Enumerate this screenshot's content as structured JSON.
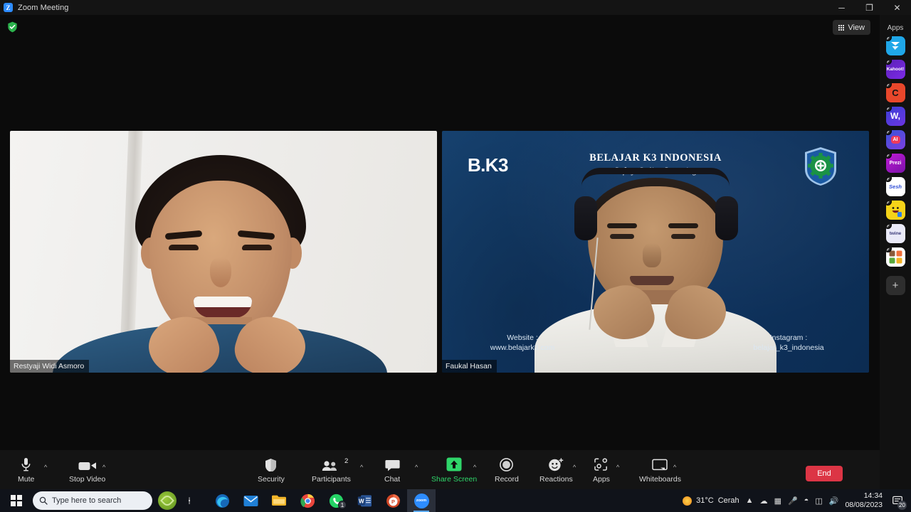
{
  "window": {
    "title": "Zoom Meeting",
    "logo_letter": "Z",
    "minimize": "─",
    "maximize": "❐",
    "close": "✕"
  },
  "header": {
    "encryption_icon": "green-shield-check-icon",
    "view_label": "View"
  },
  "participants": [
    {
      "name": "Restyaji Widi Asmoro",
      "position": "left"
    },
    {
      "name": "Faukal Hasan",
      "position": "right"
    }
  ],
  "virtual_background": {
    "logo_text": "B.K3",
    "title": "BELAJAR K3 INDONESIA",
    "subtitle": "Safety Online Learning",
    "emblem": "k3-safety-gear-shield-icon",
    "website_label": "Website :",
    "website_value": "www.belajark3.com",
    "instagram_label": "Instagram :",
    "instagram_value": "belajar_k3_indonesia",
    "bg_color": "#123a66"
  },
  "toolbar": {
    "items": [
      {
        "label": "Mute",
        "icon": "microphone-icon",
        "has_chevron": true,
        "active": false
      },
      {
        "label": "Stop Video",
        "icon": "video-camera-icon",
        "has_chevron": true,
        "active": false
      },
      {
        "label": "Security",
        "icon": "shield-icon",
        "has_chevron": false,
        "active": false
      },
      {
        "label": "Participants",
        "icon": "people-icon",
        "has_chevron": true,
        "active": false,
        "count": "2"
      },
      {
        "label": "Chat",
        "icon": "chat-bubble-icon",
        "has_chevron": true,
        "active": false
      },
      {
        "label": "Share Screen",
        "icon": "share-screen-up-arrow-icon",
        "has_chevron": true,
        "active": true
      },
      {
        "label": "Record",
        "icon": "record-circle-icon",
        "has_chevron": false,
        "active": false
      },
      {
        "label": "Reactions",
        "icon": "smiley-plus-icon",
        "has_chevron": true,
        "active": false
      },
      {
        "label": "Apps",
        "icon": "apps-icon",
        "has_chevron": true,
        "active": false
      },
      {
        "label": "Whiteboards",
        "icon": "whiteboard-icon",
        "has_chevron": true,
        "active": false
      }
    ],
    "end_label": "End",
    "more_icon": "vertical-dots-icon",
    "help_icon": "question-mark-icon",
    "accent_green": "#2fd66a",
    "end_red": "#dc3545"
  },
  "apps_rail": {
    "title": "Apps",
    "add_label": "+",
    "items": [
      {
        "name": "paper-plane-app",
        "label": "",
        "bg": "#1fa7e8",
        "fg": "#ffffff"
      },
      {
        "name": "kahoot-app",
        "label": "Kahoot!",
        "bg": "#46178f",
        "fg": "#ffffff"
      },
      {
        "name": "orange-c-app",
        "label": "C",
        "bg": "#e8472b",
        "fg": "#1a1a1a"
      },
      {
        "name": "wordwall-app",
        "label": "W,",
        "bg": "#4a46d6",
        "fg": "#ffffff"
      },
      {
        "name": "ai-companion-app",
        "label": "AI",
        "bg": "#4356d6",
        "fg": "#ffffff"
      },
      {
        "name": "prezi-app",
        "label": "Prezi",
        "bg": "#9c18c6",
        "fg": "#ffffff"
      },
      {
        "name": "sesh-app",
        "label": "Sesh",
        "bg": "#ffffff",
        "fg": "#2f4ed8"
      },
      {
        "name": "emoji-yellow-app",
        "label": "",
        "bg": "#f5d319",
        "fg": "#222222"
      },
      {
        "name": "twine-app",
        "label": "twine",
        "bg": "#e9e9f7",
        "fg": "#3b3b7a"
      },
      {
        "name": "board-grid-app",
        "label": "",
        "bg": "#ffffff",
        "fg": "#222222"
      }
    ]
  },
  "taskbar": {
    "search_placeholder": "Type here to search",
    "start_icon": "windows-start-icon",
    "cortana_icon": "cortana-icon",
    "taskview_icon": "task-view-icon",
    "apps": [
      {
        "name": "edge",
        "label": "e",
        "bg": "#1668b8",
        "badge": ""
      },
      {
        "name": "mail",
        "label": "✉",
        "bg": "#1f7fd6",
        "badge": ""
      },
      {
        "name": "file-explorer",
        "label": "▭",
        "bg": "#f0b429",
        "badge": ""
      },
      {
        "name": "chrome",
        "label": "◉",
        "bg": "#e8453c",
        "badge": ""
      },
      {
        "name": "whatsapp",
        "label": "✆",
        "bg": "#25d366",
        "badge": "1"
      },
      {
        "name": "word",
        "label": "W",
        "bg": "#2b579a",
        "badge": ""
      },
      {
        "name": "powerpoint",
        "label": "P",
        "bg": "#d24726",
        "badge": ""
      },
      {
        "name": "zoom",
        "label": "zoom",
        "bg": "#2d8cff",
        "badge": ""
      }
    ],
    "weather_temp": "31°C",
    "weather_desc": "Cerah",
    "tray_icons": [
      "chevron-up-icon",
      "onedrive-cloud-icon",
      "device-icon",
      "microphone-icon",
      "wifi-icon",
      "battery-icon",
      "volume-icon"
    ],
    "time": "14:34",
    "date": "08/08/2023",
    "notification_count": "20"
  }
}
